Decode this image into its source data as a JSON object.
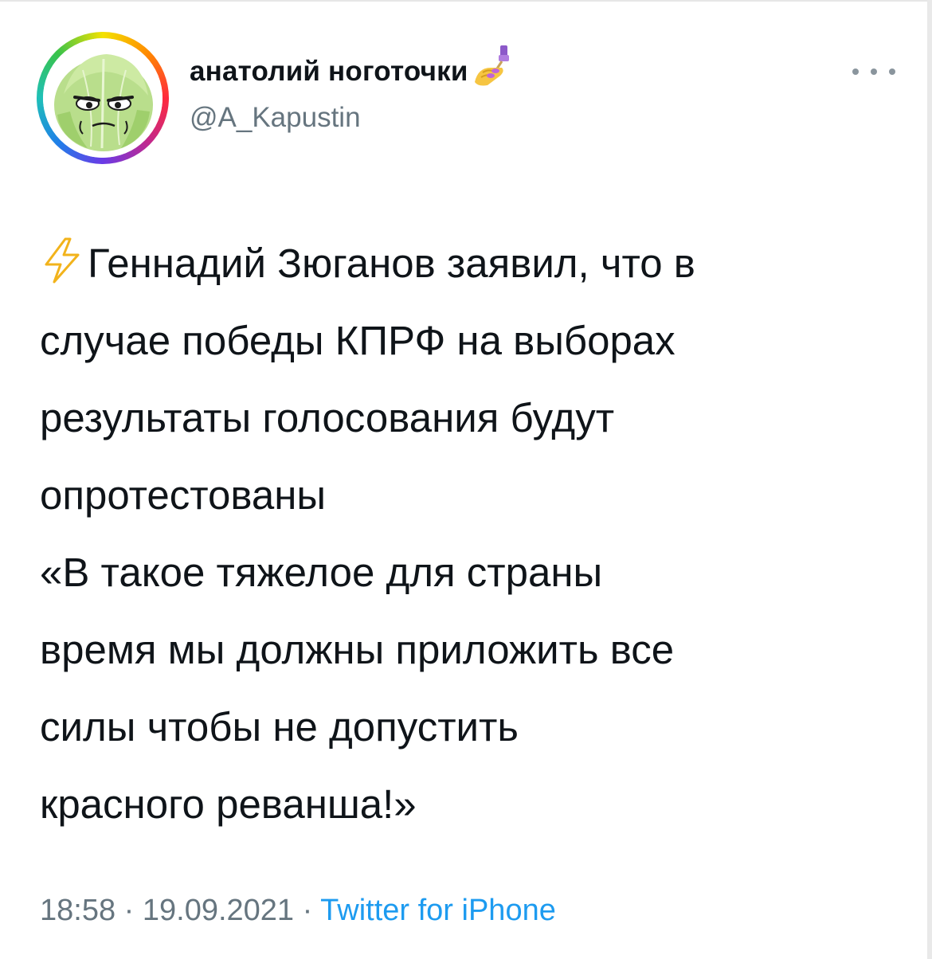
{
  "tweet": {
    "author": {
      "display_name": "анатолий ноготочки",
      "name_emoji": "nail-polish-icon",
      "handle": "@A_Kapustin",
      "avatar": "cabbage-avatar",
      "avatar_ring_colors": [
        "#f3e200",
        "#ff8a00",
        "#ff2a3c",
        "#c0288f",
        "#6a3be6",
        "#1f7fe8",
        "#1fc0b8",
        "#39c34a"
      ]
    },
    "more_icon": "more-dots-icon",
    "text_emoji": "high-voltage-icon",
    "text_lines": [
      "Геннадий Зюганов заявил, что в",
      "случае победы КПРФ на выборах",
      "результаты голосования будут",
      "опротестованы",
      "«В такое тяжелое для страны",
      "время мы должны приложить все",
      "силы чтобы не допустить",
      "красного реванша!»"
    ],
    "meta": {
      "time": "18:58",
      "separator": "·",
      "date": "19.09.2021",
      "source": "Twitter for iPhone"
    },
    "colors": {
      "text": "#0f1419",
      "secondary": "#66757f",
      "link": "#1d9bf0"
    }
  }
}
